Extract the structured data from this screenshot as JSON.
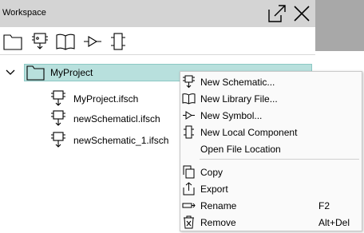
{
  "window": {
    "title": "Workspace"
  },
  "titlebar_icons": [
    "popout-icon",
    "close-icon"
  ],
  "toolbar": {
    "icons": [
      "folder-icon",
      "schematic-icon",
      "library-book-icon",
      "symbol-icon",
      "component-icon"
    ]
  },
  "tree": {
    "project": {
      "label": "MyProject",
      "expanded": true
    },
    "files": [
      {
        "label": "MyProject.ifsch"
      },
      {
        "label": "newSchematicl.ifsch"
      },
      {
        "label": "newSchematic_1.ifsch"
      }
    ]
  },
  "context_menu": {
    "items": [
      {
        "label": "New Schematic...",
        "shortcut": "",
        "icon": "schematic-icon"
      },
      {
        "label": "New Library File...",
        "shortcut": "",
        "icon": "library-book-icon"
      },
      {
        "label": "New Symbol...",
        "shortcut": "",
        "icon": "symbol-icon"
      },
      {
        "label": "New Local Component",
        "shortcut": "",
        "icon": "component-icon"
      },
      {
        "label": "Open File Location",
        "shortcut": "",
        "icon": ""
      },
      {
        "label": "Copy",
        "shortcut": "",
        "icon": "copy-icon"
      },
      {
        "label": "Export",
        "shortcut": "",
        "icon": "export-icon"
      },
      {
        "label": "Rename",
        "shortcut": "F2",
        "icon": "rename-icon"
      },
      {
        "label": "Remove",
        "shortcut": "Alt+Del",
        "icon": "remove-icon"
      }
    ]
  },
  "colors": {
    "selection": "#b8e0dd",
    "titlebar": "#d4d4d4",
    "menu_bg": "#fafafa"
  }
}
